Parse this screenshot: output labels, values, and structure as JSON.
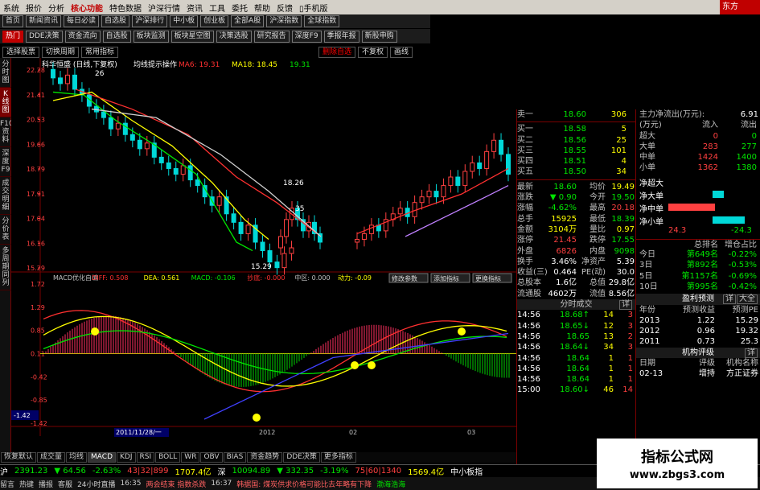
{
  "menubar": {
    "items": [
      "系统",
      "报价",
      "分析",
      "核心功能",
      "特色数据",
      "沪深行情",
      "资讯",
      "工具",
      "委托",
      "帮助",
      "反馈"
    ],
    "highlight": "核心功能",
    "phone": "手机版",
    "logo": "东方"
  },
  "navbar": {
    "items": [
      "首页",
      "新闻资讯",
      "每日必读",
      "自选股",
      "沪深排行",
      "中小板",
      "创业板",
      "全部A股",
      "沪深指数",
      "全球指数"
    ]
  },
  "toolbar": {
    "items": [
      "热门",
      "DDE决策",
      "资金流向",
      "自选股",
      "板块监测",
      "板块星空图",
      "决策选股",
      "研究报告",
      "深度F9",
      "季报年报",
      "新股申购"
    ],
    "active": "热门"
  },
  "subbar": {
    "left": [
      "选择股票",
      "切换周期",
      "常用指标"
    ],
    "right": [
      "删除自选",
      "不复权",
      "画线"
    ]
  },
  "side": {
    "tabs": [
      "分时图",
      "K线图",
      "F10资料",
      "深度F9",
      "成交明细",
      "分价表",
      "多周期同列"
    ],
    "active": "K线图"
  },
  "chart": {
    "title": "科华恒盛 (日线,下复权)",
    "hint": "均线提示操作",
    "ma_labels": [
      {
        "t": "MA6: 19.31",
        "c": "#ff3030"
      },
      {
        "t": "MA18: 18.45",
        "c": "#ffff00"
      },
      {
        "t": "19.31",
        "c": "#00e600"
      }
    ],
    "price_ticks": [
      "22.28",
      "21.41",
      "20.53",
      "19.66",
      "18.79",
      "17.91",
      "17.04",
      "16.16",
      "15.29"
    ],
    "annotations": [
      "26",
      "18.26",
      "35",
      "15.29"
    ],
    "macd_labels": [
      {
        "t": "MACD优化自编",
        "c": "#c0c0c0"
      },
      {
        "t": "DIFF: 0.508",
        "c": "#ff3030"
      },
      {
        "t": "DEA: 0.561",
        "c": "#ffff00"
      },
      {
        "t": "MACD: -0.106",
        "c": "#00e600"
      },
      {
        "t": "抄底: -0.000",
        "c": "#ff3030"
      },
      {
        "t": "中区: 0.000",
        "c": "#c0c0c0"
      },
      {
        "t": "动力: -0.09",
        "c": "#ffff00"
      }
    ],
    "macd_buttons": [
      "修改参数",
      "添加指标",
      "更换指标"
    ],
    "macd_ticks": [
      "1.72",
      "1.29",
      "0.85",
      "0.11",
      "-0.42",
      "-0.85",
      "-1.42"
    ],
    "date_labels": [
      "2011/11/28/一",
      "2012",
      "02",
      "03"
    ],
    "chart_data": {
      "type": "candlestick",
      "ylim": [
        15.29,
        22.28
      ]
    }
  },
  "footer": {
    "items": [
      "恢复默认",
      "成交量",
      "均线",
      "MACD",
      "KDJ",
      "RSI",
      "BOLL",
      "WR",
      "OBV",
      "BIAS",
      "资金趋势",
      "DDE决策",
      "更多指标"
    ]
  },
  "quote": {
    "asks": [
      {
        "l": "卖一",
        "p": "18.60",
        "v": "306"
      }
    ],
    "bids": [
      {
        "l": "买一",
        "p": "18.58",
        "v": "5"
      },
      {
        "l": "买二",
        "p": "18.56",
        "v": "25"
      },
      {
        "l": "买三",
        "p": "18.55",
        "v": "101"
      },
      {
        "l": "买四",
        "p": "18.51",
        "v": "4"
      },
      {
        "l": "买五",
        "p": "18.50",
        "v": "34"
      }
    ],
    "stats": [
      {
        "a": "最新",
        "av": "18.60",
        "ac": "grn",
        "b": "均价",
        "bv": "19.49",
        "bc": "yel"
      },
      {
        "a": "涨跌",
        "av": "▼ 0.90",
        "ac": "grn",
        "b": "今开",
        "bv": "19.50",
        "bc": "grn"
      },
      {
        "a": "涨幅",
        "av": "-4.62%",
        "ac": "grn",
        "b": "最高",
        "bv": "20.18",
        "bc": "red"
      },
      {
        "a": "总手",
        "av": "15925",
        "ac": "yel",
        "b": "最低",
        "bv": "18.39",
        "bc": "grn"
      },
      {
        "a": "金额",
        "av": "3104万",
        "ac": "yel",
        "b": "量比",
        "bv": "0.97",
        "bc": "yel"
      },
      {
        "a": "涨停",
        "av": "21.45",
        "ac": "red",
        "b": "跌停",
        "bv": "17.55",
        "bc": "grn"
      },
      {
        "a": "外盘",
        "av": "6826",
        "ac": "red",
        "b": "内盘",
        "bv": "9098",
        "bc": "grn"
      },
      {
        "a": "换手",
        "av": "3.46%",
        "ac": "wht",
        "b": "净资产",
        "bv": "5.39",
        "bc": "wht"
      },
      {
        "a": "收益(三)",
        "av": "0.464",
        "ac": "wht",
        "b": "PE(动)",
        "bv": "30.0",
        "bc": "wht"
      },
      {
        "a": "总股本",
        "av": "1.6亿",
        "ac": "wht",
        "b": "总值",
        "bv": "29.8亿",
        "bc": "wht"
      },
      {
        "a": "流通股",
        "av": "4602万",
        "ac": "wht",
        "b": "流值",
        "bv": "8.56亿",
        "bc": "wht"
      }
    ],
    "ticks_title": "分时成交",
    "ticks_btn": "详",
    "ticks": [
      {
        "t": "14:56",
        "p": "18.68↑",
        "v": "14",
        "n": "3"
      },
      {
        "t": "14:56",
        "p": "18.65↓",
        "v": "12",
        "n": "3"
      },
      {
        "t": "14:56",
        "p": "18.65",
        "v": "13",
        "n": "2"
      },
      {
        "t": "14:56",
        "p": "18.64↓",
        "v": "34",
        "n": "3"
      },
      {
        "t": "14:56",
        "p": "18.64",
        "v": "1",
        "n": "1"
      },
      {
        "t": "14:56",
        "p": "18.64",
        "v": "1",
        "n": "1"
      },
      {
        "t": "14:56",
        "p": "18.64",
        "v": "1",
        "n": "1"
      },
      {
        "t": "15:00",
        "p": "18.60↓",
        "v": "46",
        "n": "14"
      }
    ]
  },
  "flow": {
    "title": "主力净流出(万元):",
    "title_val": "6.91",
    "hdr": [
      "(万元)",
      "流入",
      "流出"
    ],
    "rows": [
      {
        "l": "超大",
        "in": "0",
        "out": "0"
      },
      {
        "l": "大单",
        "in": "283",
        "out": "277"
      },
      {
        "l": "中单",
        "in": "1424",
        "out": "1400"
      },
      {
        "l": "小单",
        "in": "1362",
        "out": "1380"
      }
    ],
    "net": [
      "净超大",
      "净大单",
      "净中单",
      "净小单"
    ],
    "net_vals": [
      "24.3",
      "-24.3"
    ],
    "inst_hdr": [
      "总排名",
      "增仓占比"
    ],
    "inst": [
      {
        "l": "今日",
        "r": "第649名",
        "p": "-0.22%"
      },
      {
        "l": "3日",
        "r": "第892名",
        "p": "-0.53%"
      },
      {
        "l": "5日",
        "r": "第1157名",
        "p": "-0.69%"
      },
      {
        "l": "10日",
        "r": "第995名",
        "p": "-0.42%"
      }
    ],
    "forecast_title": "盈利预测",
    "forecast_btns": [
      "详",
      "大全"
    ],
    "forecast_hdr": [
      "年份",
      "预测收益",
      "预测PE"
    ],
    "forecast": [
      {
        "y": "2013",
        "e": "1.22",
        "pe": "15.29"
      },
      {
        "y": "2012",
        "e": "0.96",
        "pe": "19.32"
      },
      {
        "y": "2011",
        "e": "0.73",
        "pe": "25.3"
      }
    ],
    "rating_title": "机构评级",
    "rating_btn": "详",
    "rating_hdr": [
      "日期",
      "评级",
      "机构名称"
    ],
    "rating": [
      {
        "d": "02-13",
        "r": "增持",
        "o": "方正证券"
      }
    ]
  },
  "status1": {
    "items": [
      {
        "t": "沪",
        "c": "wht"
      },
      {
        "t": "2391.23",
        "c": "grn"
      },
      {
        "t": "▼ 64.56",
        "c": "grn"
      },
      {
        "t": "-2.63%",
        "c": "grn"
      },
      {
        "t": "43|32|899",
        "c": "red"
      },
      {
        "t": "1707.4亿",
        "c": "yel"
      },
      {
        "t": "深",
        "c": "wht"
      },
      {
        "t": "10094.89",
        "c": "grn"
      },
      {
        "t": "▼ 332.35",
        "c": "grn"
      },
      {
        "t": "-3.19%",
        "c": "grn"
      },
      {
        "t": "75|60|1340",
        "c": "red"
      },
      {
        "t": "1569.4亿",
        "c": "yel"
      },
      {
        "t": "中小板指",
        "c": "wht"
      }
    ]
  },
  "status2": {
    "items": [
      "留言",
      "热键",
      "播报",
      "客服",
      "24小时直播",
      "16:35",
      "两会结束 指数杀跌",
      "16:37",
      "韩据国: 煤炭供求价格可能比去年略有下降",
      "渤海浩海"
    ]
  },
  "watermark": {
    "line1": "指标公式网",
    "line2": "www.zbgs3.com"
  }
}
